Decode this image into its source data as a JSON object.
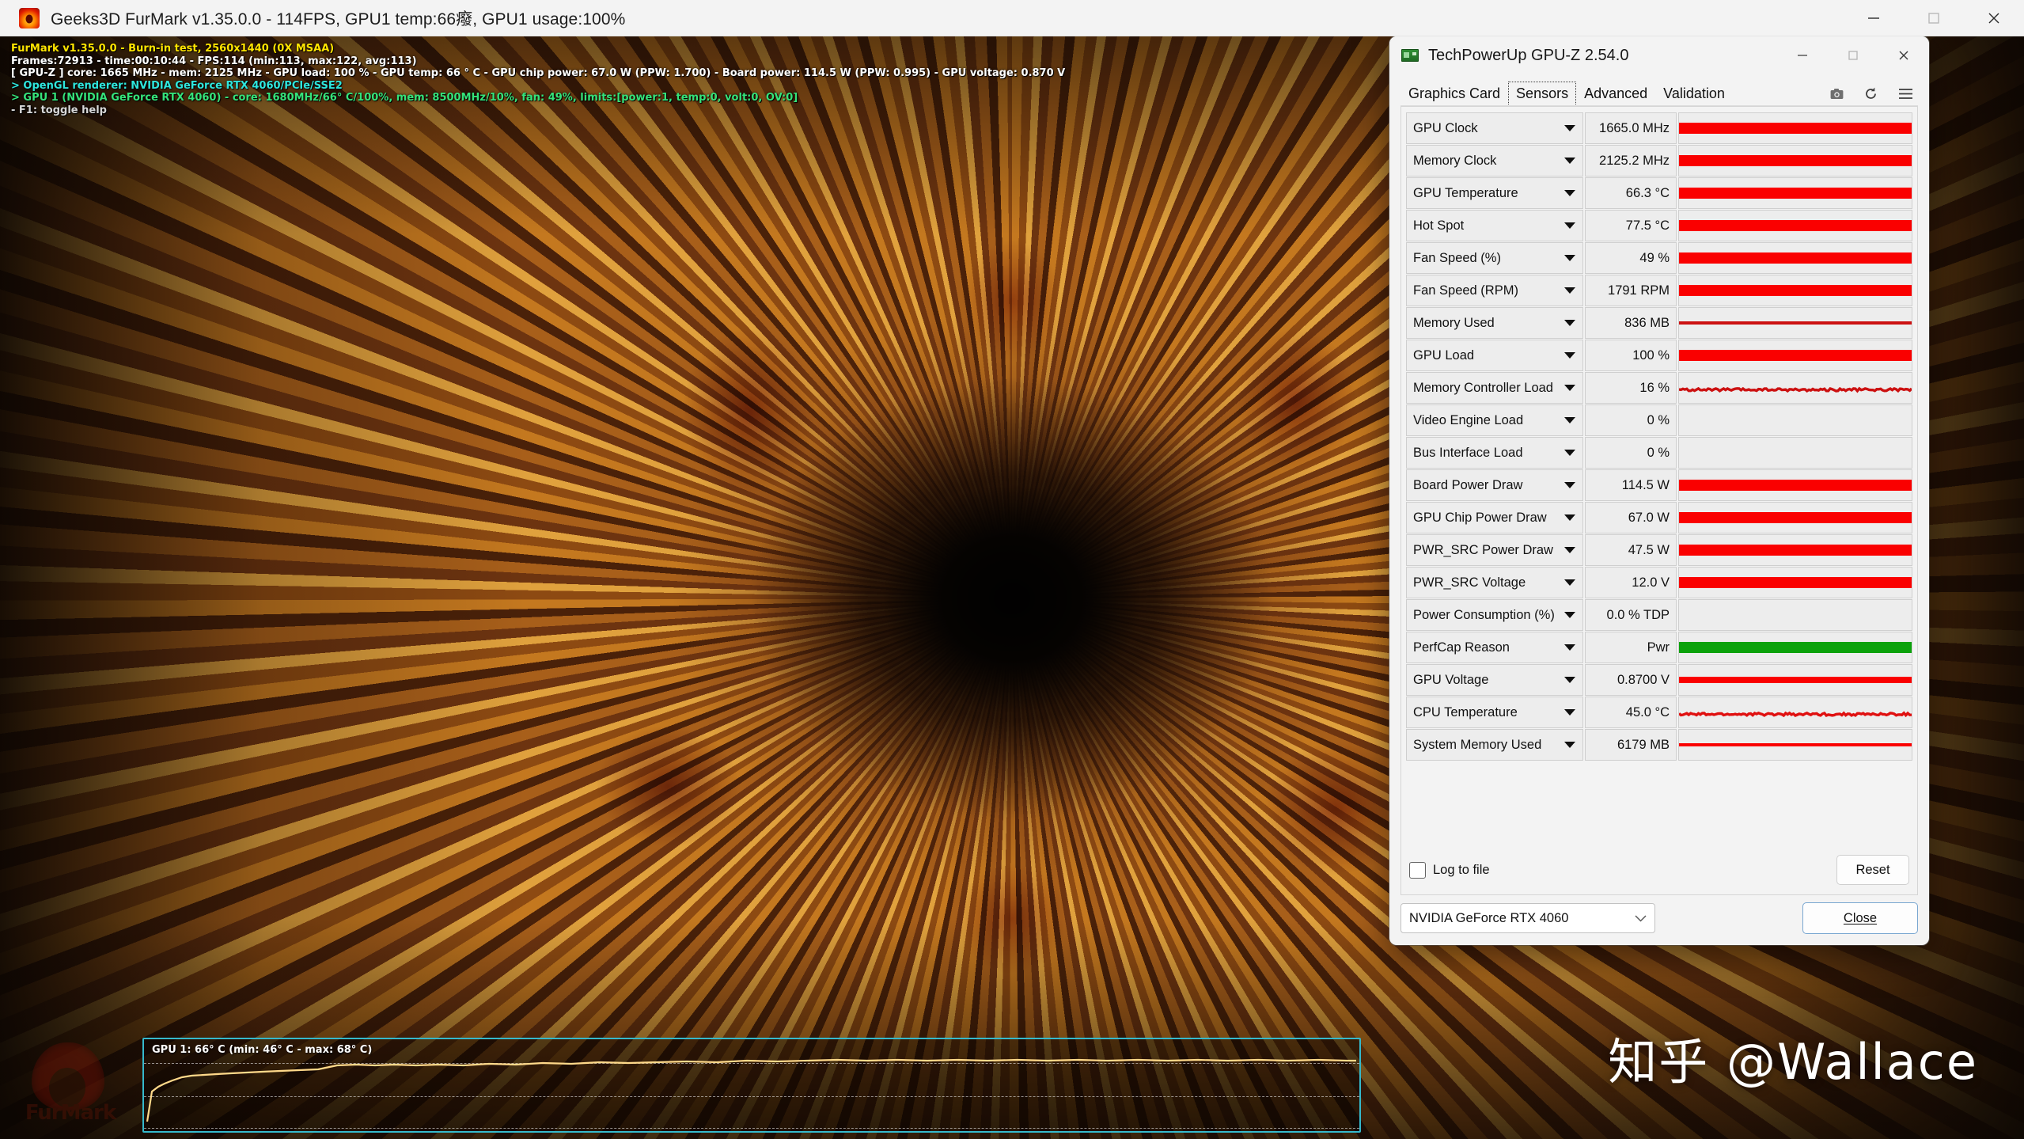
{
  "furmark": {
    "titlebar": {
      "title": "Geeks3D FurMark v1.35.0.0 - 114FPS, GPU1 temp:66癈, GPU1 usage:100%",
      "minimize_label": "Minimize",
      "maximize_label": "Maximize",
      "close_label": "Close"
    },
    "hud": {
      "line1": "FurMark v1.35.0.0 - Burn-in test, 2560x1440 (0X MSAA)",
      "line2": "Frames:72913 - time:00:10:44 - FPS:114 (min:113, max:122, avg:113)",
      "line3": "[ GPU-Z ] core: 1665 MHz - mem: 2125 MHz - GPU load: 100 % - GPU temp: 66 ° C - GPU chip power: 67.0 W (PPW: 1.700) - Board power: 114.5 W (PPW: 0.995) - GPU voltage: 0.870 V",
      "line4": "> OpenGL renderer: NVIDIA GeForce RTX 4060/PCIe/SSE2",
      "line5": "> GPU 1 (NVIDIA GeForce RTX 4060) - core: 1680MHz/66° C/100%, mem: 8500MHz/10%, fan: 49%, limits:[power:1, temp:0, volt:0, OV:0]",
      "line6": "- F1: toggle help"
    },
    "temp_graph": {
      "label": "GPU 1: 66° C (min: 46° C - max: 68° C)",
      "line_color": "#ffd98a",
      "border_color": "#35b9cc"
    },
    "logo_text": "FurMark"
  },
  "watermark": {
    "text": "知乎 @Wallace"
  },
  "gpuz": {
    "titlebar": {
      "title": "TechPowerUp GPU-Z 2.54.0",
      "minimize_label": "Minimize",
      "maximize_label": "Maximize",
      "close_label": "Close"
    },
    "tabs": [
      {
        "label": "Graphics Card",
        "active": false
      },
      {
        "label": "Sensors",
        "active": true
      },
      {
        "label": "Advanced",
        "active": false
      },
      {
        "label": "Validation",
        "active": false
      }
    ],
    "tab_icons": [
      {
        "name": "camera-icon"
      },
      {
        "name": "refresh-icon"
      },
      {
        "name": "hamburger-menu-icon"
      }
    ],
    "sensors": [
      {
        "name": "GPU Clock",
        "value": "1665.0 MHz",
        "bar": "full",
        "color": "#fa0000",
        "thickness": "bar"
      },
      {
        "name": "Memory Clock",
        "value": "2125.2 MHz",
        "bar": "full",
        "color": "#fa0000",
        "thickness": "bar"
      },
      {
        "name": "GPU Temperature",
        "value": "66.3 °C",
        "bar": "full",
        "color": "#fa0000",
        "thickness": "bar"
      },
      {
        "name": "Hot Spot",
        "value": "77.5 °C",
        "bar": "full",
        "color": "#fa0000",
        "thickness": "bar"
      },
      {
        "name": "Fan Speed (%)",
        "value": "49 %",
        "bar": "full",
        "color": "#fa0000",
        "thickness": "bar"
      },
      {
        "name": "Fan Speed (RPM)",
        "value": "1791 RPM",
        "bar": "full",
        "color": "#fa0000",
        "thickness": "bar"
      },
      {
        "name": "Memory Used",
        "value": "836 MB",
        "bar": "thin",
        "color": "#cc1111",
        "thickness": "thin"
      },
      {
        "name": "GPU Load",
        "value": "100 %",
        "bar": "full",
        "color": "#fa0000",
        "thickness": "bar"
      },
      {
        "name": "Memory Controller Load",
        "value": "16 %",
        "bar": "noisy",
        "color": "#cc1111",
        "thickness": "thin"
      },
      {
        "name": "Video Engine Load",
        "value": "0 %",
        "bar": "none",
        "color": "#fa0000",
        "thickness": "none"
      },
      {
        "name": "Bus Interface Load",
        "value": "0 %",
        "bar": "none",
        "color": "#fa0000",
        "thickness": "none"
      },
      {
        "name": "Board Power Draw",
        "value": "114.5 W",
        "bar": "full",
        "color": "#fa0000",
        "thickness": "bar"
      },
      {
        "name": "GPU Chip Power Draw",
        "value": "67.0 W",
        "bar": "full",
        "color": "#fa0000",
        "thickness": "bar"
      },
      {
        "name": "PWR_SRC Power Draw",
        "value": "47.5 W",
        "bar": "full",
        "color": "#fa0000",
        "thickness": "bar"
      },
      {
        "name": "PWR_SRC Voltage",
        "value": "12.0 V",
        "bar": "full",
        "color": "#fa0000",
        "thickness": "bar"
      },
      {
        "name": "Power Consumption (%)",
        "value": "0.0 % TDP",
        "bar": "none",
        "color": "#fa0000",
        "thickness": "none"
      },
      {
        "name": "PerfCap Reason",
        "value": "Pwr",
        "bar": "full",
        "color": "#0ba20b",
        "thickness": "bar"
      },
      {
        "name": "GPU Voltage",
        "value": "0.8700 V",
        "bar": "med",
        "color": "#fa0000",
        "thickness": "med"
      },
      {
        "name": "CPU Temperature",
        "value": "45.0 °C",
        "bar": "noisy",
        "color": "#e01010",
        "thickness": "thin"
      },
      {
        "name": "System Memory Used",
        "value": "6179 MB",
        "bar": "thin",
        "color": "#fa0000",
        "thickness": "thin"
      }
    ],
    "footer": {
      "log_to_file_label": "Log to file",
      "log_to_file_checked": false,
      "reset_label": "Reset"
    },
    "bottom": {
      "gpu_selected": "NVIDIA GeForce RTX 4060",
      "close_label": "Close"
    }
  }
}
